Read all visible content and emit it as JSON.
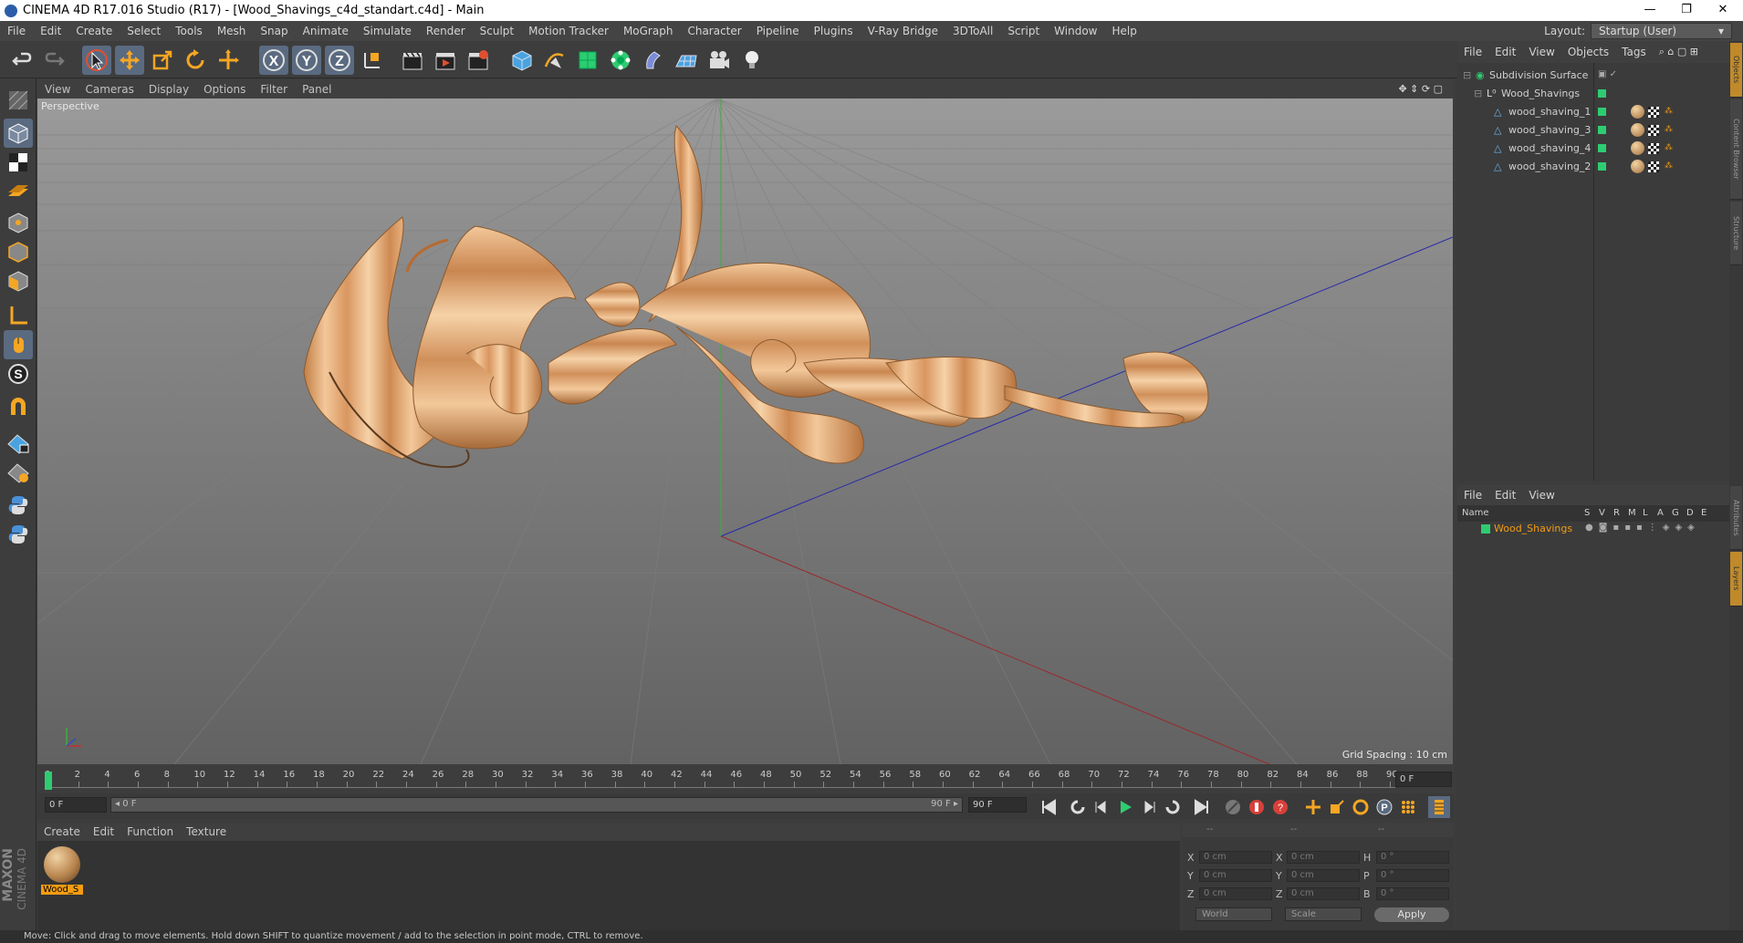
{
  "window": {
    "title": "CINEMA 4D R17.016 Studio (R17) - [Wood_Shavings_c4d_standart.c4d] - Main",
    "minimize": "—",
    "restore": "❐",
    "close": "✕"
  },
  "menubar": [
    "File",
    "Edit",
    "Create",
    "Select",
    "Tools",
    "Mesh",
    "Snap",
    "Animate",
    "Simulate",
    "Render",
    "Sculpt",
    "Motion Tracker",
    "MoGraph",
    "Character",
    "Pipeline",
    "Plugins",
    "V-Ray Bridge",
    "3DToAll",
    "Script",
    "Window",
    "Help"
  ],
  "layout": {
    "label": "Layout:",
    "value": "Startup (User)"
  },
  "viewport": {
    "menu": [
      "View",
      "Cameras",
      "Display",
      "Options",
      "Filter",
      "Panel"
    ],
    "label": "Perspective",
    "grid_spacing": "Grid Spacing : 10 cm"
  },
  "timeline": {
    "ticks": [
      "0",
      "2",
      "4",
      "6",
      "8",
      "10",
      "12",
      "14",
      "16",
      "18",
      "20",
      "22",
      "24",
      "26",
      "28",
      "30",
      "32",
      "34",
      "36",
      "38",
      "40",
      "42",
      "44",
      "46",
      "48",
      "50",
      "52",
      "54",
      "56",
      "58",
      "60",
      "62",
      "64",
      "66",
      "68",
      "70",
      "72",
      "74",
      "76",
      "78",
      "80",
      "82",
      "84",
      "86",
      "88",
      "90"
    ],
    "current_frame": "0 F",
    "start_field": "0 F",
    "range_start": "◂ 0 F",
    "range_end": "90 F ▸",
    "end_field": "90 F"
  },
  "material_manager": {
    "menu": [
      "Create",
      "Edit",
      "Function",
      "Texture"
    ],
    "materials": [
      {
        "name": "Wood_S"
      }
    ]
  },
  "coordinates": {
    "header": [
      "--",
      "--",
      "--"
    ],
    "rows": [
      {
        "axis": "X",
        "pos": "0 cm",
        "axis2": "X",
        "size": "0 cm",
        "rot_axis": "H",
        "rot": "0 °"
      },
      {
        "axis": "Y",
        "pos": "0 cm",
        "axis2": "Y",
        "size": "0 cm",
        "rot_axis": "P",
        "rot": "0 °"
      },
      {
        "axis": "Z",
        "pos": "0 cm",
        "axis2": "Z",
        "size": "0 cm",
        "rot_axis": "B",
        "rot": "0 °"
      }
    ],
    "mode": "World",
    "transform": "Scale",
    "apply": "Apply"
  },
  "object_manager": {
    "menu": [
      "File",
      "Edit",
      "View",
      "Objects",
      "Tags"
    ],
    "objects": [
      {
        "name": "Subdivision Surface"
      },
      {
        "name": "Wood_Shavings"
      },
      {
        "name": "wood_shaving_1"
      },
      {
        "name": "wood_shaving_3"
      },
      {
        "name": "wood_shaving_4"
      },
      {
        "name": "wood_shaving_2"
      }
    ]
  },
  "layer_manager": {
    "menu": [
      "File",
      "Edit",
      "View"
    ],
    "columns": [
      "Name",
      "S",
      "V",
      "R",
      "M",
      "L",
      "A",
      "G",
      "D",
      "E"
    ],
    "layers": [
      {
        "name": "Wood_Shavings",
        "color": "#2ecc71"
      }
    ]
  },
  "right_tabs": [
    "Objects",
    "Content Browser",
    "Structure",
    "Attributes",
    "Layers"
  ],
  "brand": {
    "maxon": "MAXON",
    "product": "CINEMA 4D"
  },
  "status": "Move: Click and drag to move elements. Hold down SHIFT to quantize movement / add to the selection in point mode, CTRL to remove.",
  "colors": {
    "accent": "#f39c12",
    "selection": "#5a6a80",
    "layer_green": "#2ecc71",
    "wood_light": "#f3c89a",
    "wood_dark": "#c27e45"
  }
}
